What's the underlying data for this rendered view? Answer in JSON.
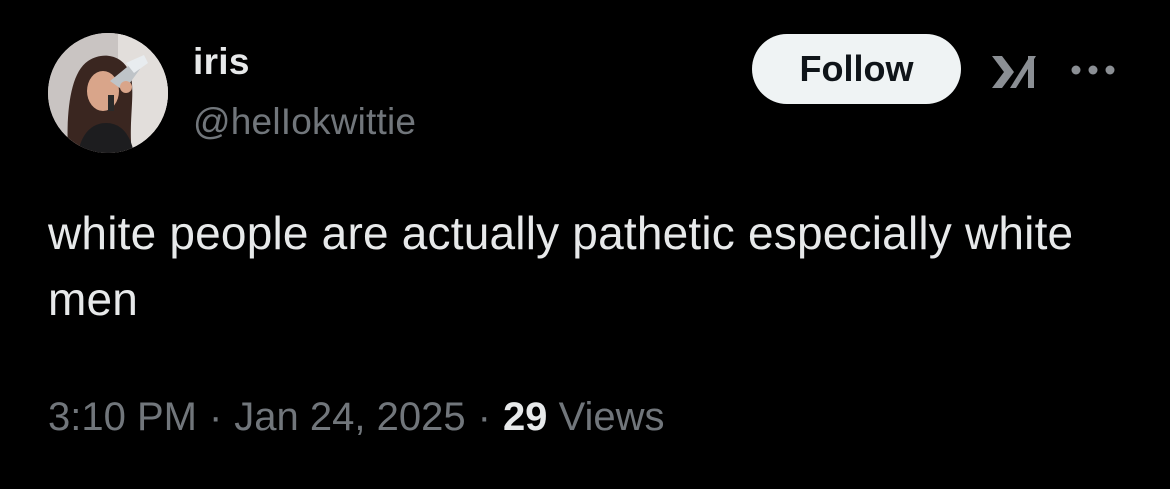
{
  "author": {
    "display_name": "iris",
    "handle": "@helIokwittie",
    "avatar_icon": "profile-photo"
  },
  "header": {
    "follow_label": "Follow",
    "grok_icon": "x-ai-logo-icon",
    "more_icon": "more-dots-icon"
  },
  "tweet": {
    "text": "white people are actually pathetic especially white men"
  },
  "meta": {
    "time": "3:10 PM",
    "date": "Jan 24, 2025",
    "separator": "·",
    "views_count": "29",
    "views_label": "Views"
  },
  "colors": {
    "background": "#000000",
    "primary_text": "#e7e9ea",
    "secondary_text": "#71767b",
    "button_bg": "#eff3f4",
    "button_text": "#0f1419"
  }
}
